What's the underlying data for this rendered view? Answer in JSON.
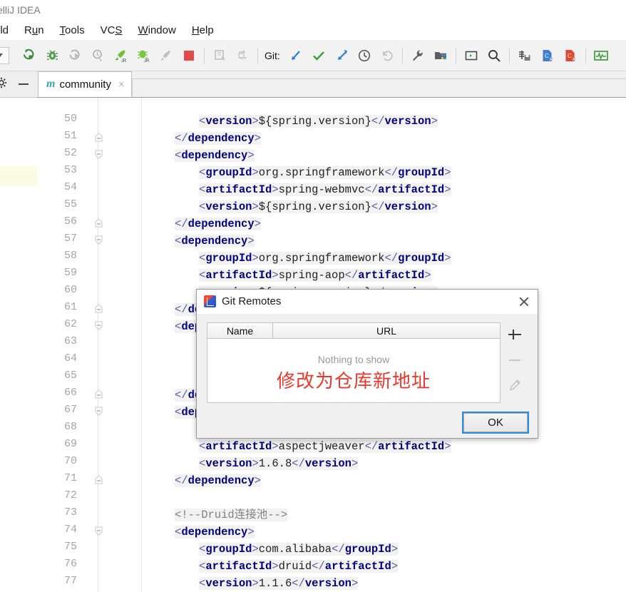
{
  "window": {
    "title": "elliJ IDEA"
  },
  "menu": {
    "items": [
      {
        "label": "ild",
        "pre": "",
        "mnemonic": "",
        "post": "ild"
      },
      {
        "label": "Run"
      },
      {
        "label": "Tools"
      },
      {
        "label": "VCS"
      },
      {
        "label": "Window"
      },
      {
        "label": "Help"
      }
    ]
  },
  "toolbar": {
    "git_label": "Git:",
    "icons": [
      "run-icon",
      "debug-icon",
      "run-with-coverage-icon",
      "profile-icon",
      "run-jr-icon",
      "debug-jr-icon",
      "attach-process-icon",
      "stop-icon",
      "build-icon",
      "sync-icon",
      "update-project-icon",
      "commit-icon",
      "push-icon",
      "history-icon",
      "rollback-icon",
      "settings-wrench-icon",
      "project-structure-icon",
      "terminal-icon",
      "search-icon",
      "save-all-icon",
      "blue-doc-icon",
      "red-doc-icon",
      "monitor-icon"
    ]
  },
  "left_strip": {
    "gear_icon": "gear-icon",
    "minimize_icon": "minimize-icon"
  },
  "tabs": [
    {
      "label": "community",
      "module_marker": "m",
      "close": "×"
    }
  ],
  "editor": {
    "lines": [
      {
        "n": 50,
        "fold": "",
        "indent": 2,
        "parts": [
          [
            "br",
            "<"
          ],
          [
            "tg",
            "version"
          ],
          [
            "br",
            ">"
          ],
          [
            "txt",
            "${spring.version}"
          ],
          [
            "br",
            "</"
          ],
          [
            "tg",
            "version"
          ],
          [
            "br",
            ">"
          ]
        ]
      },
      {
        "n": 51,
        "fold": "end",
        "indent": 0,
        "parts": [
          [
            "br",
            "</"
          ],
          [
            "tg",
            "dependency"
          ],
          [
            "br",
            ">"
          ]
        ]
      },
      {
        "n": 52,
        "fold": "start",
        "indent": 0,
        "parts": [
          [
            "br",
            "<"
          ],
          [
            "tg",
            "dependency"
          ],
          [
            "br",
            ">"
          ]
        ]
      },
      {
        "n": 53,
        "fold": "",
        "indent": 2,
        "parts": [
          [
            "br",
            "<"
          ],
          [
            "tg",
            "groupId"
          ],
          [
            "br",
            ">"
          ],
          [
            "txt",
            "org.springframework"
          ],
          [
            "br",
            "</"
          ],
          [
            "tg",
            "groupId"
          ],
          [
            "br",
            ">"
          ]
        ]
      },
      {
        "n": 54,
        "fold": "",
        "indent": 2,
        "parts": [
          [
            "br",
            "<"
          ],
          [
            "tg",
            "artifactId"
          ],
          [
            "br",
            ">"
          ],
          [
            "txt",
            "spring-webmvc"
          ],
          [
            "br",
            "</"
          ],
          [
            "tg",
            "artifactId"
          ],
          [
            "br",
            ">"
          ]
        ]
      },
      {
        "n": 55,
        "fold": "",
        "indent": 2,
        "parts": [
          [
            "br",
            "<"
          ],
          [
            "tg",
            "version"
          ],
          [
            "br",
            ">"
          ],
          [
            "txt",
            "${spring.version}"
          ],
          [
            "br",
            "</"
          ],
          [
            "tg",
            "version"
          ],
          [
            "br",
            ">"
          ]
        ]
      },
      {
        "n": 56,
        "fold": "end",
        "indent": 0,
        "parts": [
          [
            "br",
            "</"
          ],
          [
            "tg",
            "dependency"
          ],
          [
            "br",
            ">"
          ]
        ]
      },
      {
        "n": 57,
        "fold": "start",
        "indent": 0,
        "parts": [
          [
            "br",
            "<"
          ],
          [
            "tg",
            "dependency"
          ],
          [
            "br",
            ">"
          ]
        ]
      },
      {
        "n": 58,
        "fold": "",
        "indent": 2,
        "parts": [
          [
            "br",
            "<"
          ],
          [
            "tg",
            "groupId"
          ],
          [
            "br",
            ">"
          ],
          [
            "txt",
            "org.springframework"
          ],
          [
            "br",
            "</"
          ],
          [
            "tg",
            "groupId"
          ],
          [
            "br",
            ">"
          ]
        ]
      },
      {
        "n": 59,
        "fold": "",
        "indent": 2,
        "parts": [
          [
            "br",
            "<"
          ],
          [
            "tg",
            "artifactId"
          ],
          [
            "br",
            ">"
          ],
          [
            "txt",
            "spring-aop"
          ],
          [
            "br",
            "</"
          ],
          [
            "tg",
            "artifactId"
          ],
          [
            "br",
            ">"
          ]
        ]
      },
      {
        "n": 60,
        "fold": "",
        "indent": 2,
        "parts": [
          [
            "br",
            "<"
          ],
          [
            "tg",
            "version"
          ],
          [
            "br",
            ">"
          ],
          [
            "txt",
            "${spring.version}"
          ],
          [
            "br",
            "</"
          ],
          [
            "tg",
            "version"
          ],
          [
            "br",
            ">"
          ]
        ]
      },
      {
        "n": 61,
        "fold": "end",
        "indent": 0,
        "parts": [
          [
            "br",
            "</"
          ],
          [
            "tg",
            "dependency"
          ],
          [
            "br",
            ">"
          ]
        ]
      },
      {
        "n": 62,
        "fold": "start",
        "indent": 0,
        "parts": [
          [
            "br",
            "<"
          ],
          [
            "tg",
            "dependency"
          ],
          [
            "br",
            ">"
          ]
        ]
      },
      {
        "n": 63,
        "fold": "",
        "indent": 2,
        "parts": []
      },
      {
        "n": 64,
        "fold": "",
        "indent": 2,
        "parts": []
      },
      {
        "n": 65,
        "fold": "",
        "indent": 2,
        "parts": []
      },
      {
        "n": 66,
        "fold": "end",
        "indent": 0,
        "parts": [
          [
            "br",
            "</"
          ],
          [
            "tg",
            "dependency"
          ],
          [
            "br",
            ">"
          ]
        ]
      },
      {
        "n": 67,
        "fold": "start",
        "indent": 0,
        "parts": [
          [
            "br",
            "<"
          ],
          [
            "tg",
            "dependency"
          ],
          [
            "br",
            ">"
          ]
        ]
      },
      {
        "n": 68,
        "fold": "",
        "indent": 2,
        "parts": []
      },
      {
        "n": 69,
        "fold": "",
        "indent": 2,
        "parts": [
          [
            "br",
            "<"
          ],
          [
            "tg",
            "artifactId"
          ],
          [
            "br",
            ">"
          ],
          [
            "txt",
            "aspectjweaver"
          ],
          [
            "br",
            "</"
          ],
          [
            "tg",
            "artifactId"
          ],
          [
            "br",
            ">"
          ]
        ]
      },
      {
        "n": 70,
        "fold": "",
        "indent": 2,
        "parts": [
          [
            "br",
            "<"
          ],
          [
            "tg",
            "version"
          ],
          [
            "br",
            ">"
          ],
          [
            "txt",
            "1.6.8"
          ],
          [
            "br",
            "</"
          ],
          [
            "tg",
            "version"
          ],
          [
            "br",
            ">"
          ]
        ]
      },
      {
        "n": 71,
        "fold": "end",
        "indent": 0,
        "parts": [
          [
            "br",
            "</"
          ],
          [
            "tg",
            "dependency"
          ],
          [
            "br",
            ">"
          ]
        ]
      },
      {
        "n": 72,
        "fold": "",
        "indent": 0,
        "parts": []
      },
      {
        "n": 73,
        "fold": "",
        "indent": 0,
        "parts": [
          [
            "cm",
            "<!--Druid连接池-->"
          ]
        ]
      },
      {
        "n": 74,
        "fold": "start",
        "indent": 0,
        "parts": [
          [
            "br",
            "<"
          ],
          [
            "tg",
            "dependency"
          ],
          [
            "br",
            ">"
          ]
        ]
      },
      {
        "n": 75,
        "fold": "",
        "indent": 2,
        "parts": [
          [
            "br",
            "<"
          ],
          [
            "tg",
            "groupId"
          ],
          [
            "br",
            ">"
          ],
          [
            "txt",
            "com.alibaba"
          ],
          [
            "br",
            "</"
          ],
          [
            "tg",
            "groupId"
          ],
          [
            "br",
            ">"
          ]
        ]
      },
      {
        "n": 76,
        "fold": "",
        "indent": 2,
        "parts": [
          [
            "br",
            "<"
          ],
          [
            "tg",
            "artifactId"
          ],
          [
            "br",
            ">"
          ],
          [
            "txt",
            "druid"
          ],
          [
            "br",
            "</"
          ],
          [
            "tg",
            "artifactId"
          ],
          [
            "br",
            ">"
          ]
        ]
      },
      {
        "n": 77,
        "fold": "",
        "indent": 2,
        "parts": [
          [
            "br",
            "<"
          ],
          [
            "tg",
            "version"
          ],
          [
            "br",
            ">"
          ],
          [
            "txt",
            "1.1.6"
          ],
          [
            "br",
            "</"
          ],
          [
            "tg",
            "version"
          ],
          [
            "br",
            ">"
          ]
        ]
      }
    ]
  },
  "dialog": {
    "title": "Git Remotes",
    "icon": "intellij-idea-icon",
    "close_label": "close-icon",
    "table": {
      "columns": [
        "Name",
        "URL"
      ],
      "rows": [],
      "empty_message": "Nothing to show"
    },
    "annotation": "修改为仓库新地址",
    "annotation_color": "#e8392c",
    "side_buttons": [
      {
        "name": "add-remote-button",
        "glyph": "+"
      },
      {
        "name": "remove-remote-button",
        "glyph": "−"
      },
      {
        "name": "edit-remote-button",
        "glyph": "✎"
      }
    ],
    "ok_label": "OK"
  }
}
